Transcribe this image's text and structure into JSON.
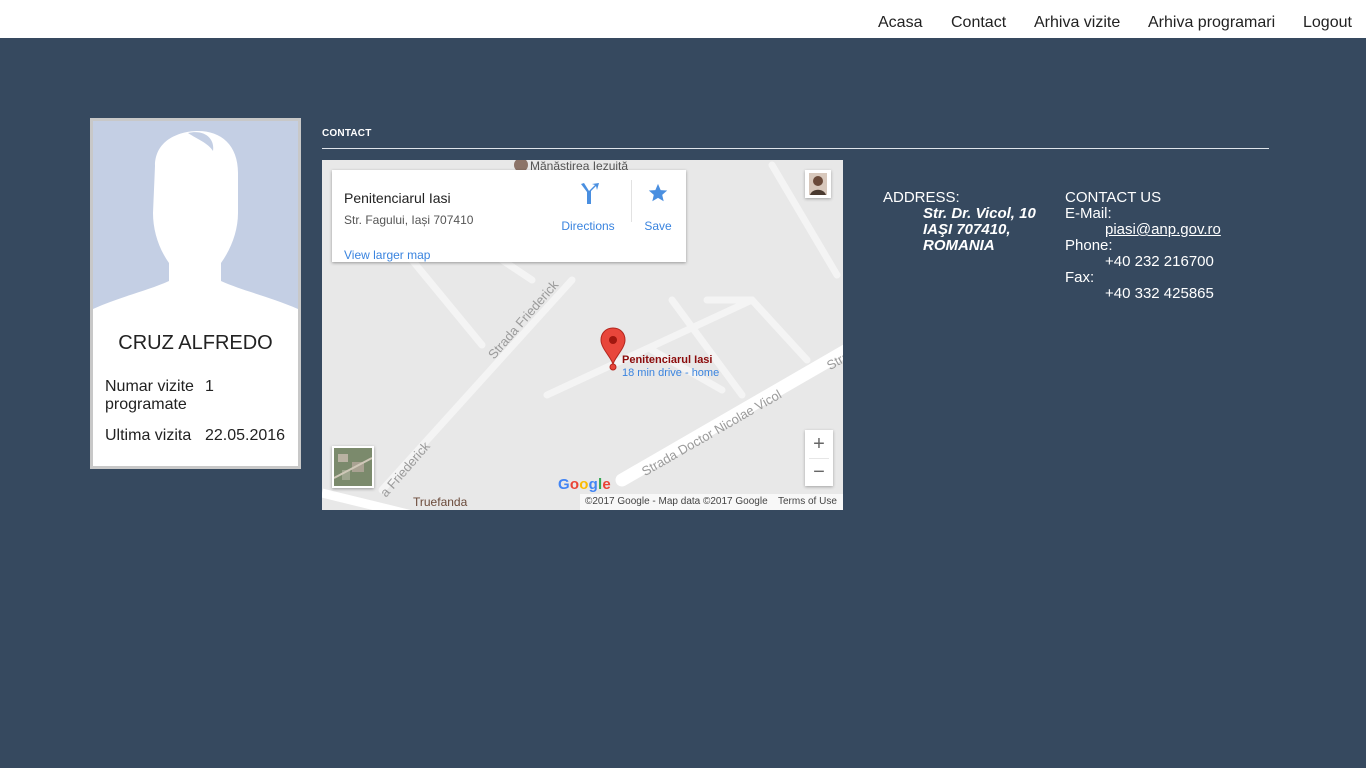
{
  "nav": {
    "items": [
      "Acasa",
      "Contact",
      "Arhiva vizite",
      "Arhiva programari",
      "Logout"
    ]
  },
  "profile": {
    "name": "CRUZ ALFREDO",
    "visits_label_1": "Numar vizite",
    "visits_label_2": "programate",
    "visits_value": "1",
    "last_visit_label": "Ultima vizita",
    "last_visit_value": "22.05.2016"
  },
  "contact": {
    "title": "CONTACT"
  },
  "map": {
    "place_name": "Penitenciarul Iasi",
    "place_address": "Str. Fagului, Iași 707410",
    "directions_label": "Directions",
    "save_label": "Save",
    "view_larger": "View larger map",
    "pin_title": "Penitenciarul Iasi",
    "pin_subtitle": "18 min drive - home",
    "poi_top": "Mănăstirea Iezuită",
    "poi_bottom": "Truefanda",
    "street_1": "Strada Friederick",
    "street_2": "Strada Friederick",
    "street_2_partial": "a Friederick",
    "street_3": "Strada Doctor Nicolae Vicol",
    "street_4": "Stra",
    "zoom_in": "+",
    "zoom_out": "−",
    "google_logo": "Google",
    "attribution": "©2017 Google - Map data ©2017 Google",
    "terms": "Terms of Use"
  },
  "address": {
    "heading": "ADDRESS:",
    "line1": "Str. Dr. Vicol, 10",
    "line2": "IAŞI 707410,",
    "line3": "ROMANIA"
  },
  "contact_us": {
    "heading": "CONTACT US",
    "email_label": "E-Mail:",
    "email_value": "piasi@anp.gov.ro",
    "phone_label": "Phone:",
    "phone_value": "+40 232 216700",
    "fax_label": "Fax:",
    "fax_value": "+40 332 425865"
  },
  "colors": {
    "background": "#36495f",
    "nav_bg": "#ffffff",
    "link_blue": "#3a84df",
    "pin_red": "#e8463b"
  },
  "icons": {
    "directions": "directions-icon",
    "save": "star-icon",
    "pin": "map-pin-icon",
    "avatar": "user-silhouette-icon"
  }
}
